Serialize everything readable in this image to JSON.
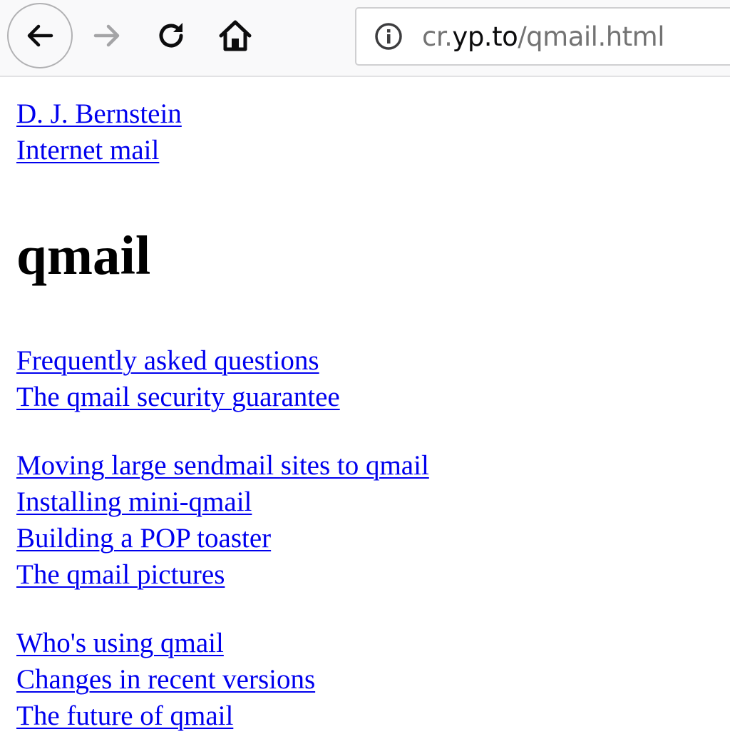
{
  "browser": {
    "url_prefix": "cr.",
    "url_domain": "yp.to",
    "url_path": "/qmail.html",
    "icons": {
      "back": "back-arrow-icon",
      "forward": "forward-arrow-icon",
      "reload": "reload-icon",
      "home": "home-icon",
      "info": "info-icon"
    }
  },
  "page": {
    "top_links": [
      "D. J. Bernstein",
      "Internet mail"
    ],
    "title": "qmail",
    "groups": [
      [
        "Frequently asked questions",
        "The qmail security guarantee"
      ],
      [
        "Moving large sendmail sites to qmail",
        "Installing mini-qmail",
        "Building a POP toaster",
        "The qmail pictures"
      ],
      [
        "Who's using qmail",
        "Changes in recent versions",
        "The future of qmail"
      ]
    ]
  },
  "colors": {
    "link": "#0000ee",
    "toolbar_bg": "#f9f9fa",
    "url_text": "#737373"
  }
}
